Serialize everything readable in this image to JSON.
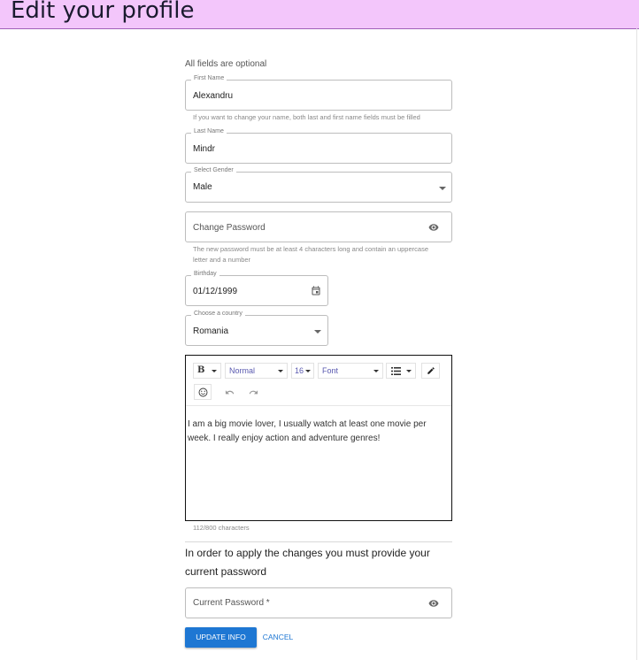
{
  "header": {
    "title": "Edit your profile"
  },
  "form": {
    "optional_note": "All fields are optional",
    "first_name": {
      "label": "First Name",
      "value": "Alexandru",
      "helper": "If you want to change your name, both last and first name fields must be filled"
    },
    "last_name": {
      "label": "Last Name",
      "value": "Mindr"
    },
    "gender": {
      "label": "Select Gender",
      "value": "Male"
    },
    "password": {
      "placeholder": "Change Password",
      "helper_line1": "The new password must be at least 4 characters long and contain an uppercase",
      "helper_line2": "letter and a number"
    },
    "birthday": {
      "label": "Birthday",
      "value": "01/12/1999"
    },
    "country": {
      "label": "Choose a country",
      "value": "Romania"
    }
  },
  "editor": {
    "toolbar": {
      "bold": "B",
      "block_style": "Normal",
      "font_size": "16",
      "font_family": "Font"
    },
    "content": "I am a big movie lover, I usually watch at least one movie per week. I really enjoy action and adventure genres!",
    "char_count": "112/800 characters"
  },
  "confirm": {
    "notice": "In order to apply the changes you must provide your current password",
    "current_password_placeholder": "Current Password *"
  },
  "actions": {
    "update": "UPDATE INFO",
    "cancel": "CANCEL"
  },
  "icons": {
    "password_visibility": "eye-icon",
    "birthday_picker": "calendar-icon",
    "select_caret": "caret-down-icon",
    "list": "list-icon",
    "pen": "pen-icon",
    "emoji": "emoji-icon",
    "undo": "undo-icon",
    "redo": "redo-icon"
  },
  "colors": {
    "header_bg": "#f3c6fb",
    "primary": "#1e77d3",
    "toolbar_accent": "#5a5ab0"
  }
}
